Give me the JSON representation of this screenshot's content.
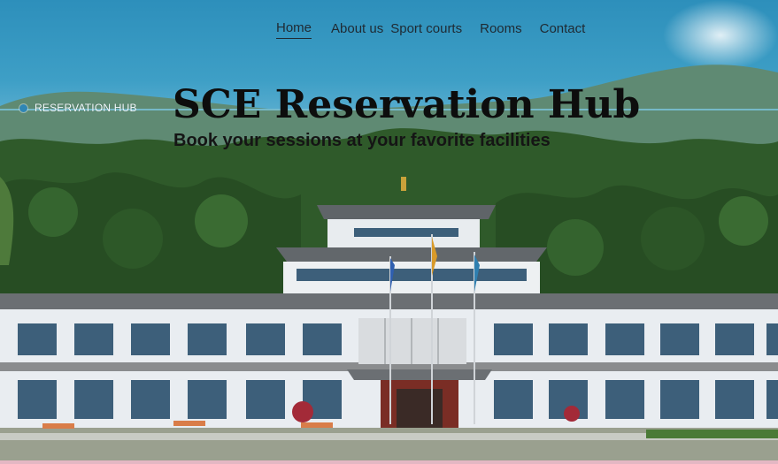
{
  "nav": {
    "items": [
      {
        "label": "Home",
        "active": true
      },
      {
        "label": "About us"
      },
      {
        "label": "Sport courts"
      },
      {
        "label": "Rooms"
      },
      {
        "label": "Contact"
      }
    ]
  },
  "brand": {
    "label": "RESERVATION HUB"
  },
  "hero": {
    "title": "SCE Reservation Hub",
    "subtitle": "Book your sessions at your favorite facilities"
  },
  "colors": {
    "sky": "#3e9fc6",
    "forest": "#2f5a2a",
    "building_wall": "#e9edf1",
    "window": "#3d5f7a",
    "roof": "#6b6f73",
    "accent_dot": "#2f86b5",
    "footer_bar": "#e4b7c3"
  }
}
